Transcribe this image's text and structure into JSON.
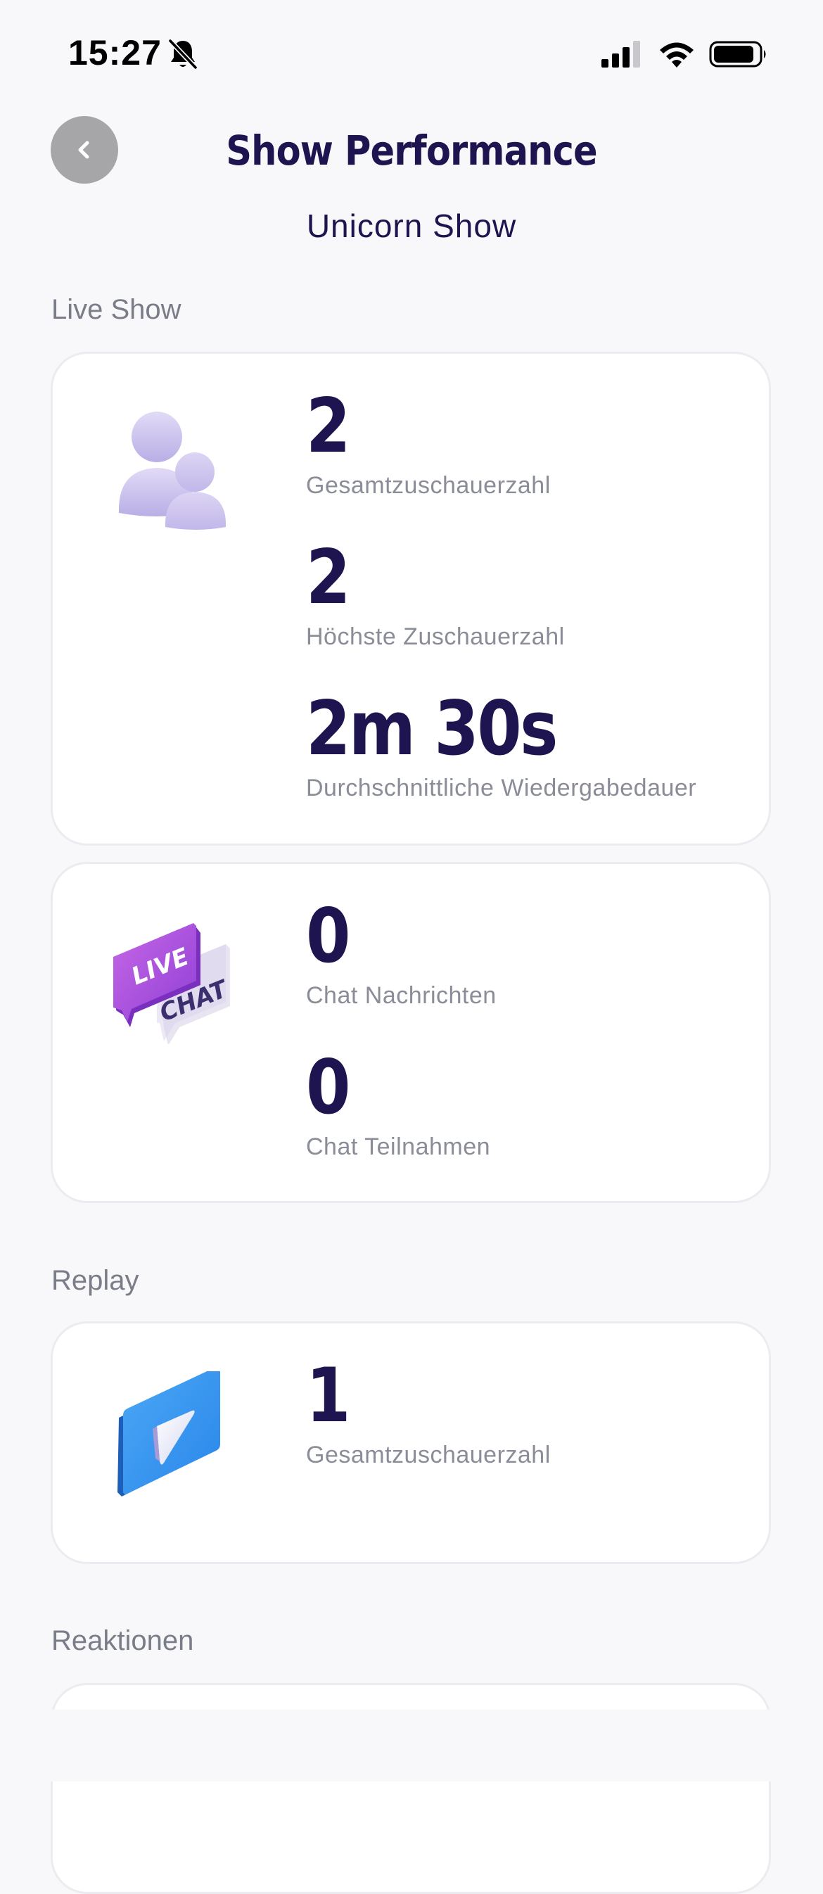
{
  "status_bar": {
    "time": "15:27"
  },
  "header": {
    "title": "Show Performance",
    "subtitle": "Unicorn Show"
  },
  "sections": {
    "live_show": {
      "label": "Live Show",
      "viewers_card": {
        "icon": "users-icon",
        "stats": [
          {
            "value": "2",
            "label": "Gesamtzuschauerzahl"
          },
          {
            "value": "2",
            "label": "Höchste Zuschauerzahl"
          },
          {
            "value": "2m 30s",
            "label": "Durchschnittliche Wiedergabedauer"
          }
        ]
      },
      "chat_card": {
        "icon": "live-chat-icon",
        "icon_text_1": "LIVE",
        "icon_text_2": "CHAT",
        "stats": [
          {
            "value": "0",
            "label": "Chat Nachrichten"
          },
          {
            "value": "0",
            "label": "Chat Teilnahmen"
          }
        ]
      }
    },
    "replay": {
      "label": "Replay",
      "replay_card": {
        "icon": "play-icon",
        "stats": [
          {
            "value": "1",
            "label": "Gesamtzuschauerzahl"
          }
        ]
      }
    },
    "reactions": {
      "label": "Reaktionen"
    }
  },
  "colors": {
    "background": "#f8f8fa",
    "primary_text": "#1e1550",
    "secondary_text": "#8a8d97",
    "back_button": "#a6a6a8"
  }
}
